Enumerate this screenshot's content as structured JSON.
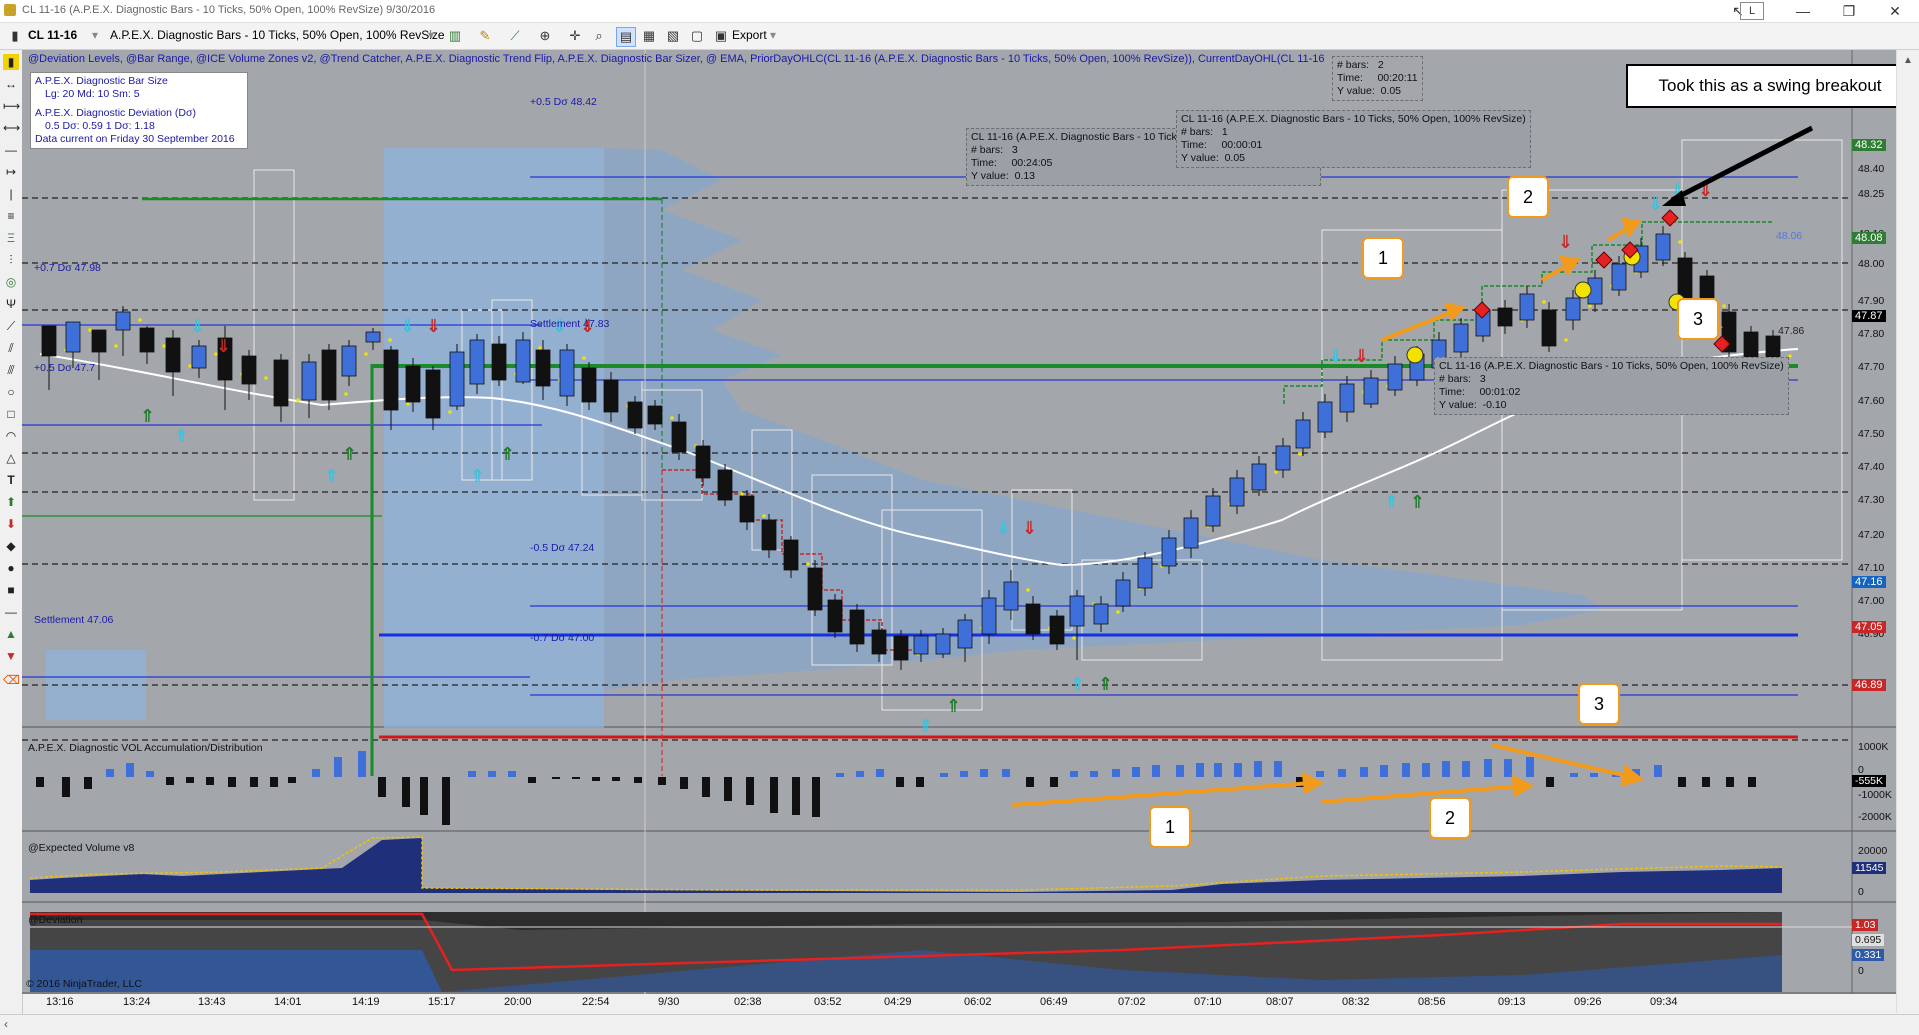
{
  "window": {
    "title": "CL 11-16 (A.P.E.X. Diagnostic Bars - 10 Ticks, 50% Open, 100% RevSize)  9/30/2016",
    "controls": [
      "↖",
      "L",
      "—",
      "❐",
      "✕"
    ]
  },
  "toolbar": {
    "instrument": "CL 11-16",
    "bars_type": "A.P.E.X. Diagnostic Bars - 10 Ticks, 50% Open, 100% RevSize",
    "export_label": "Export"
  },
  "indicator_header": "@Deviation Levels, @Bar Range, @ICE Volume Zones v2, @Trend Catcher, A.P.E.X. Diagnostic Trend Flip, A.P.E.X. Diagnostic Bar Sizer, @ EMA, PriorDayOHLC(CL 11-16 (A.P.E.X. Diagnostic Bars - 10 Ticks, 50% Open, 100% RevSize)), CurrentDayOHL(CL 11-16",
  "legend": {
    "line1": "A.P.E.X. Diagnostic Bar Size",
    "line2": "Lg: 20   Md: 10   Sm: 5",
    "line3": "A.P.E.X. Diagnostic Deviation (Dσ)",
    "line4": "0.5 Dσ: 0.59   1   Dσ: 1.18",
    "line5": "Data current on Friday 30 September 2016"
  },
  "level_labels": {
    "p05": "+0.5 Dσ 48.42",
    "p07": "+0.7 Dσ 47.98",
    "settle1": "Settlement 47.83",
    "p05b": "+0.5 Dσ 47.7",
    "m05": "-0.5 Dσ 47.24",
    "settle2": "Settlement 47.06",
    "m07": "-0.7 Dσ 47.00",
    "r4806": "48.06",
    "r4786": "47.86"
  },
  "info_boxes": {
    "box1": "CL 11-16 (A.P.E.X. Diagnostic Bars - 10 Ticks, 50% Open, 100% RevSize)\n# bars:   3\nTime:     00:24:05\nY value:  0.13",
    "box2": "CL 11-16 (A.P.E.X. Diagnostic Bars - 10 Ticks, 50% Open, 100% RevSize)\n# bars:   1\nTime:     00:00:01\nY value:  0.05",
    "box3": "# bars:   2\nTime:     00:20:11\nY value:  0.05",
    "box4": "CL 11-16 (A.P.E.X. Diagnostic Bars - 10 Ticks, 50% Open, 100% RevSize)\n# bars:   3\nTime:     00:01:02\nY value:  -0.10"
  },
  "callout": "Took this as a swing breakout",
  "numbers": {
    "one": "1",
    "two": "2",
    "three": "3"
  },
  "price_axis": {
    "ticks": [
      "48.40",
      "48.25",
      "48.10",
      "48.00",
      "47.90",
      "47.80",
      "47.70",
      "47.60",
      "47.50",
      "47.40",
      "47.30",
      "47.20",
      "47.10",
      "47.00",
      "46.90"
    ],
    "badges": [
      {
        "label": "48.32",
        "bg": "#2e7d32"
      },
      {
        "label": "48.08",
        "bg": "#2e7d32"
      },
      {
        "label": "47.87",
        "bg": "#000000"
      },
      {
        "label": "47.16",
        "bg": "#1565c0"
      },
      {
        "label": "47.05",
        "bg": "#c62828"
      },
      {
        "label": "46.89",
        "bg": "#c62828"
      }
    ]
  },
  "panels": {
    "vol_title": "A.P.E.X. Diagnostic VOL Accumulation/Distribution",
    "vol_ticks": [
      "1000K",
      "0",
      "-1000K",
      "-2000K"
    ],
    "vol_badge": "-555K",
    "ev_title": "@Expected Volume v8",
    "ev_ticks": [
      "20000",
      "0"
    ],
    "ev_badge": "11545",
    "dev_title": "@Deviation",
    "dev_ticks": [
      "0"
    ],
    "dev_badges": [
      "1.03",
      "0.695",
      "0.331"
    ]
  },
  "copyright": "© 2016 NinjaTrader, LLC",
  "time_axis": [
    "13:16",
    "13:24",
    "13:43",
    "14:01",
    "14:19",
    "15:17",
    "20:00",
    "22:54",
    "9/30",
    "02:38",
    "03:52",
    "04:29",
    "06:02",
    "06:49",
    "07:02",
    "07:10",
    "08:07",
    "08:32",
    "08:56",
    "09:13",
    "09:26",
    "09:34"
  ],
  "colors": {
    "chart_bg": "#a3a6ab",
    "up_bar": "#3f6fd8",
    "down_bar": "#111111",
    "ema": "#ffffff",
    "annotation": "#f29a1c"
  }
}
